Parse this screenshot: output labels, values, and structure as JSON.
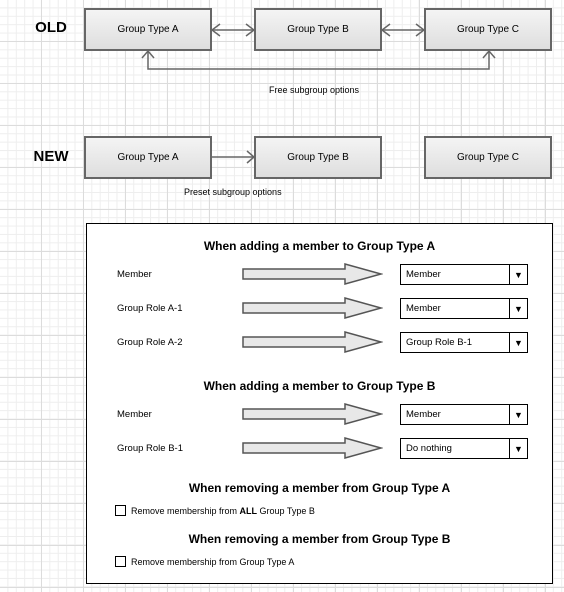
{
  "old": {
    "label": "OLD",
    "boxes": [
      "Group Type A",
      "Group Type B",
      "Group Type C"
    ],
    "caption": "Free subgroup options"
  },
  "new": {
    "label": "NEW",
    "boxes": [
      "Group Type A",
      "Group Type B",
      "Group Type C"
    ],
    "caption": "Preset subgroup options"
  },
  "panel": {
    "add_a": {
      "title": "When adding a member to Group Type A",
      "rows": [
        {
          "label": "Member",
          "value": "Member"
        },
        {
          "label": "Group Role A-1",
          "value": "Member"
        },
        {
          "label": "Group Role A-2",
          "value": "Group Role B-1"
        }
      ]
    },
    "add_b": {
      "title": "When adding a member to Group Type B",
      "rows": [
        {
          "label": "Member",
          "value": "Member"
        },
        {
          "label": "Group Role B-1",
          "value": "Do nothing"
        }
      ]
    },
    "remove_a": {
      "title": "When removing a member from Group Type A",
      "checkbox": {
        "prefix": "Remove membership from ",
        "emphasis": "ALL",
        "suffix": " Group Type B",
        "checked": false
      }
    },
    "remove_b": {
      "title": "When removing a member from Group Type B",
      "checkbox": {
        "label": "Remove membership from Group Type A",
        "checked": false
      }
    },
    "caret_glyph": "▼"
  }
}
